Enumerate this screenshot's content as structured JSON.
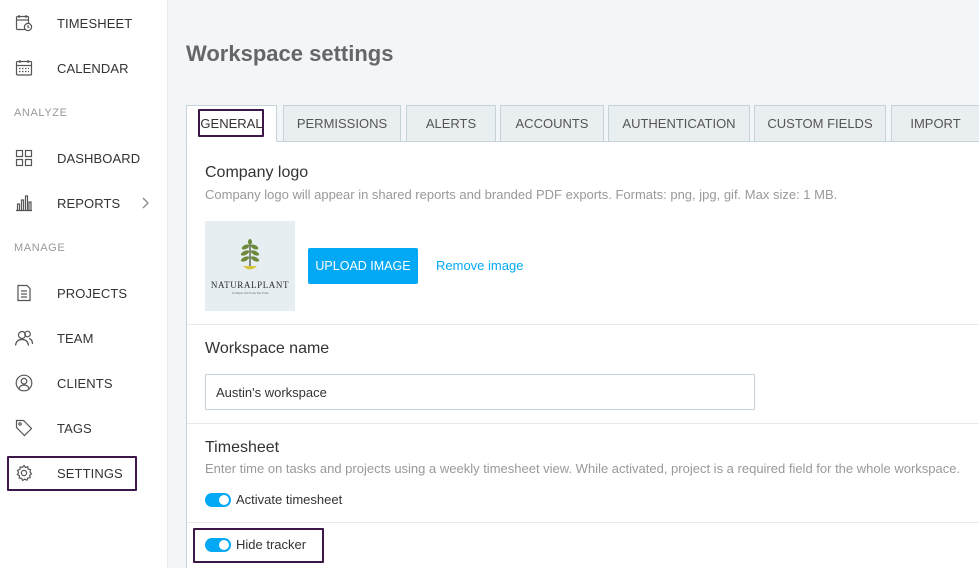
{
  "sidebar": {
    "items": [
      {
        "label": "TIMESHEET",
        "icon": "timesheet-icon"
      },
      {
        "label": "CALENDAR",
        "icon": "calendar-icon"
      },
      {
        "label": "DASHBOARD",
        "icon": "dashboard-icon"
      },
      {
        "label": "REPORTS",
        "icon": "reports-icon"
      },
      {
        "label": "PROJECTS",
        "icon": "projects-icon"
      },
      {
        "label": "TEAM",
        "icon": "team-icon"
      },
      {
        "label": "CLIENTS",
        "icon": "clients-icon"
      },
      {
        "label": "TAGS",
        "icon": "tag-icon"
      },
      {
        "label": "SETTINGS",
        "icon": "gear-icon"
      }
    ],
    "sections": {
      "analyze": "ANALYZE",
      "manage": "MANAGE"
    },
    "selected": "SETTINGS"
  },
  "page": {
    "title": "Workspace settings"
  },
  "tabs": [
    {
      "label": "GENERAL",
      "active": true
    },
    {
      "label": "PERMISSIONS",
      "active": false
    },
    {
      "label": "ALERTS",
      "active": false
    },
    {
      "label": "ACCOUNTS",
      "active": false
    },
    {
      "label": "AUTHENTICATION",
      "active": false
    },
    {
      "label": "CUSTOM FIELDS",
      "active": false
    },
    {
      "label": "IMPORT",
      "active": false
    }
  ],
  "company_logo": {
    "heading": "Company logo",
    "description": "Company logo will appear in shared reports and branded PDF exports. Formats: png, jpg, gif. Max size: 1 MB.",
    "logo_text": "NATURALPLANT",
    "logo_tagline": "A Simple Life From The Farm",
    "upload_label": "UPLOAD IMAGE",
    "remove_label": "Remove image"
  },
  "workspace_name": {
    "heading": "Workspace name",
    "value": "Austin's workspace"
  },
  "timesheet": {
    "heading": "Timesheet",
    "description": "Enter time on tasks and projects using a weekly timesheet view. While activated, project is a required field for the whole workspace.",
    "activate_label": "Activate timesheet",
    "activate_on": true,
    "hide_tracker_label": "Hide tracker",
    "hide_tracker_on": true
  },
  "colors": {
    "accent": "#03a9f4",
    "highlight": "#3c1848",
    "sidebar_bg": "#ffffff",
    "page_bg": "#f2f6f8"
  }
}
